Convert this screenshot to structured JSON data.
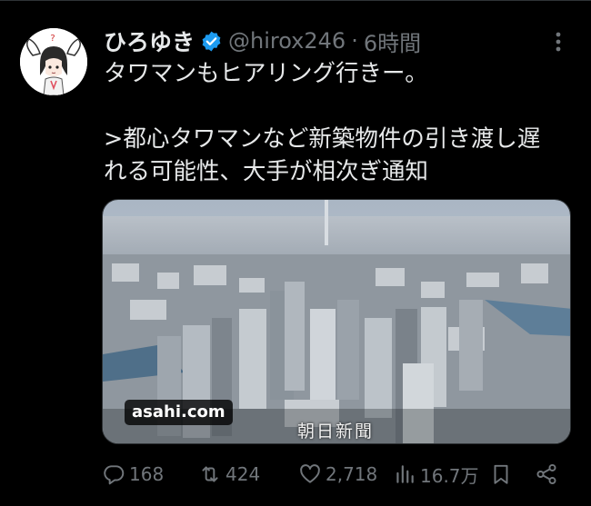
{
  "tweet": {
    "author_name": "ひろゆき",
    "handle": "@hirox246",
    "separator": "·",
    "time": "6時間",
    "text_lines": [
      "タワマンもヒアリング行きー。",
      ">都心タワマンなど新築物件の引き渡し遅",
      "れる可能性、大手が相次ぎ通知"
    ],
    "media": {
      "domain": "asahi.com",
      "caption": "朝日新聞"
    },
    "actions": {
      "replies": "168",
      "reposts": "424",
      "likes": "2,718",
      "views": "16.7万"
    }
  },
  "icons": {
    "verified": "verified-badge-icon",
    "more": "more-options-icon",
    "reply": "reply-icon",
    "repost": "repost-icon",
    "like": "heart-icon",
    "views": "views-icon",
    "bookmark": "bookmark-icon",
    "share": "share-icon"
  },
  "colors": {
    "background": "#000000",
    "text": "#e7e9ea",
    "secondary": "#71767b",
    "verified": "#1d9bf0"
  }
}
